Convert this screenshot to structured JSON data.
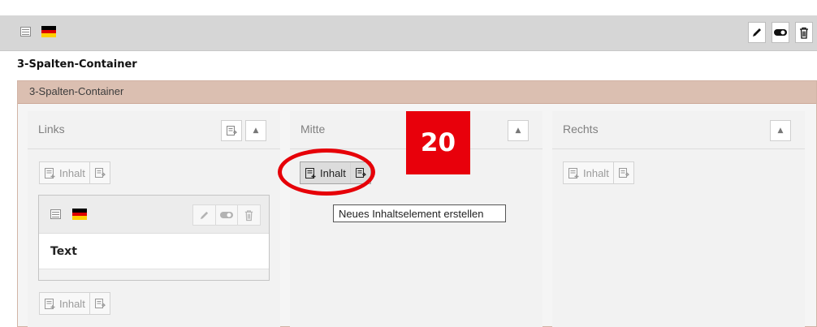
{
  "element": {
    "type_icon": "grid-layout-icon",
    "language_flag": "flag-de-icon",
    "actions": [
      "pencil-icon",
      "toggle-icon",
      "trash-icon"
    ],
    "title": "3-Spalten-Container"
  },
  "container": {
    "name": "3-Spalten-Container",
    "columns": [
      {
        "label": "Links",
        "content_button": "Inhalt"
      },
      {
        "label": "Mitte",
        "content_button": "Inhalt"
      },
      {
        "label": "Rechts",
        "content_button": "Inhalt"
      }
    ]
  },
  "card": {
    "title": "Text",
    "actions": [
      "pencil-icon",
      "toggle-icon",
      "trash-icon"
    ]
  },
  "tooltip": {
    "text": "Neues Inhaltselement erstellen"
  },
  "annotation": {
    "step": "20"
  },
  "colors": {
    "badge": "#e8000b",
    "container_header": "#dbbfb1"
  }
}
